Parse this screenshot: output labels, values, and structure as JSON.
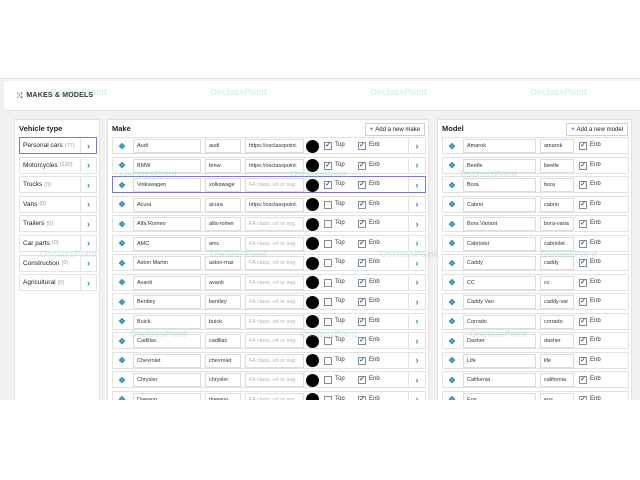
{
  "header": {
    "title": "MAKES & MODELS",
    "icon": "shuffle-icon"
  },
  "vehicle_type": {
    "title": "Vehicle type",
    "items": [
      {
        "label": "Personal cars",
        "count": "(77)",
        "active": true
      },
      {
        "label": "Motorcycles",
        "count": "(120)"
      },
      {
        "label": "Trucks",
        "count": "(0)"
      },
      {
        "label": "Vans",
        "count": "(0)"
      },
      {
        "label": "Trailers",
        "count": "(0)"
      },
      {
        "label": "Car parts",
        "count": "(0)"
      },
      {
        "label": "Construction",
        "count": "(0)"
      },
      {
        "label": "Agricultural",
        "count": "(0)"
      }
    ]
  },
  "make": {
    "title": "Make",
    "add_label": "Add a new make",
    "top_label": "Top",
    "enb_label": "Enb",
    "icon_placeholder": "FA class, url or svg",
    "rows": [
      {
        "name": "Audi",
        "slug": "audi",
        "icon": "https://osclasspoint.",
        "top": true,
        "enb": true
      },
      {
        "name": "BMW",
        "slug": "bmw",
        "icon": "https://osclasspoint.",
        "top": true,
        "enb": true
      },
      {
        "name": "Volkswagen",
        "slug": "volkswage",
        "icon": "",
        "top": true,
        "enb": true,
        "active": true
      },
      {
        "name": "Acura",
        "slug": "acura",
        "icon": "https://osclasspoint.",
        "top": false,
        "enb": true
      },
      {
        "name": "Alfa Romeo",
        "slug": "alfa-romer",
        "icon": "",
        "top": false,
        "enb": true
      },
      {
        "name": "AMC",
        "slug": "amc",
        "icon": "",
        "top": false,
        "enb": true
      },
      {
        "name": "Aston Martin",
        "slug": "aston-mar",
        "icon": "",
        "top": false,
        "enb": true
      },
      {
        "name": "Avanti",
        "slug": "avanti",
        "icon": "",
        "top": false,
        "enb": true
      },
      {
        "name": "Bentley",
        "slug": "bentley",
        "icon": "",
        "top": false,
        "enb": true
      },
      {
        "name": "Buick",
        "slug": "buick",
        "icon": "",
        "top": false,
        "enb": true
      },
      {
        "name": "Cadillac",
        "slug": "cadillac",
        "icon": "",
        "top": false,
        "enb": true
      },
      {
        "name": "Chevrolet",
        "slug": "chevrolet",
        "icon": "",
        "top": false,
        "enb": true
      },
      {
        "name": "Chrysler",
        "slug": "chrysler",
        "icon": "",
        "top": false,
        "enb": true
      },
      {
        "name": "Daewoo",
        "slug": "daewoo",
        "icon": "",
        "top": false,
        "enb": true
      }
    ]
  },
  "model": {
    "title": "Model",
    "add_label": "Add a new model",
    "enb_label": "Enb",
    "rows": [
      {
        "name": "Amarok",
        "slug": "amarok",
        "enb": true
      },
      {
        "name": "Beetle",
        "slug": "beetle",
        "enb": true
      },
      {
        "name": "Bora",
        "slug": "bora",
        "enb": true
      },
      {
        "name": "Cabrio",
        "slug": "cabrio",
        "enb": true
      },
      {
        "name": "Bora Variant",
        "slug": "bora-varia",
        "enb": true
      },
      {
        "name": "Cabriolet",
        "slug": "cabriolet",
        "enb": true
      },
      {
        "name": "Caddy",
        "slug": "caddy",
        "enb": true
      },
      {
        "name": "CC",
        "slug": "cc",
        "enb": true
      },
      {
        "name": "Caddy Van",
        "slug": "caddy-var",
        "enb": true
      },
      {
        "name": "Corrado",
        "slug": "corrado",
        "enb": true
      },
      {
        "name": "Dasher",
        "slug": "dasher",
        "enb": true
      },
      {
        "name": "Life",
        "slug": "life",
        "enb": true
      },
      {
        "name": "California",
        "slug": "california",
        "enb": true
      },
      {
        "name": "Eos",
        "slug": "eos",
        "enb": true
      }
    ]
  },
  "watermark": "OsclassPoint",
  "colors": {
    "accent": "#2a8ab8",
    "active_border": "#7b77c9",
    "checkbox": "#1a6fc4"
  }
}
